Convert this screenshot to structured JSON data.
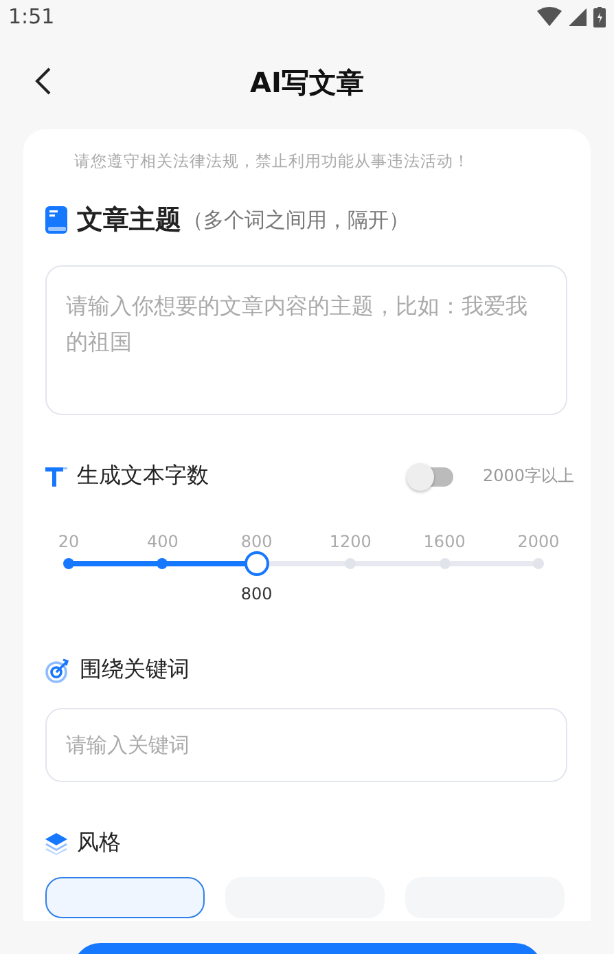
{
  "status_bar": {
    "time": "1:51"
  },
  "header": {
    "title": "AI写文章"
  },
  "notice": "请您遵守相关法律法规，禁止利用功能从事违法活动！",
  "topic": {
    "title": "文章主题",
    "hint": "（多个词之间用，隔开）",
    "placeholder": "请输入你想要的文章内容的主题，比如：我爱我的祖国"
  },
  "word_count": {
    "title": "生成文本字数",
    "toggle_on": false,
    "toggle_label": "2000字以上",
    "ticks": [
      {
        "label": "20"
      },
      {
        "label": "400"
      },
      {
        "label": "800"
      },
      {
        "label": "1200"
      },
      {
        "label": "1600"
      },
      {
        "label": "2000"
      }
    ],
    "level": 0.4,
    "value": "800"
  },
  "keywords": {
    "title": "围绕关键词",
    "placeholder": "请输入关键词"
  },
  "style": {
    "title": "风格",
    "options": [
      {
        "selected": true
      },
      {
        "selected": false
      },
      {
        "selected": false
      }
    ]
  }
}
